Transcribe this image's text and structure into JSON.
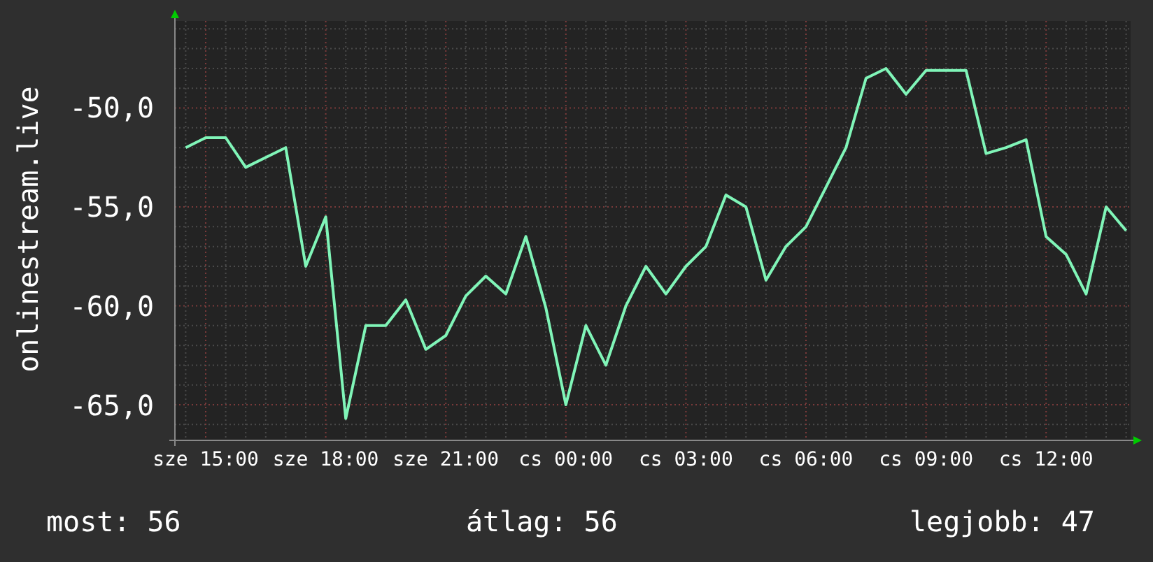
{
  "chart_data": {
    "type": "line",
    "grid": true,
    "ylabel": "onlinestream.live",
    "ylim": [
      -66.8,
      -45.6
    ],
    "categories": [
      null,
      "sze 15:00",
      null,
      null,
      null,
      null,
      null,
      "sze 18:00",
      null,
      null,
      null,
      null,
      null,
      "sze 21:00",
      null,
      null,
      null,
      null,
      null,
      "cs 00:00",
      null,
      null,
      null,
      null,
      null,
      "cs 03:00",
      null,
      null,
      null,
      null,
      null,
      "cs 06:00",
      null,
      null,
      null,
      null,
      null,
      "cs 09:00",
      null,
      null,
      null,
      null,
      null,
      "cs 12:00",
      null,
      null,
      null,
      null
    ],
    "yticks": [
      {
        "value": -50,
        "label": "-50,0"
      },
      {
        "value": -55,
        "label": "-55,0"
      },
      {
        "value": -60,
        "label": "-60,0"
      },
      {
        "value": -65,
        "label": "-65,0"
      }
    ],
    "series": [
      {
        "color": "#80f5b8",
        "values": [
          -52,
          -51.5,
          -51.5,
          -53,
          -52.5,
          -52,
          -58,
          -55.5,
          -65.7,
          -61,
          -61,
          -59.7,
          -62.2,
          -61.5,
          -59.5,
          -58.5,
          -59.4,
          -56.5,
          -60.1,
          -65,
          -61,
          -63,
          -60,
          -58,
          -59.4,
          -58,
          -57,
          -54.4,
          -55,
          -58.7,
          -57,
          -56,
          -54,
          -52,
          -48.5,
          -48,
          -49.3,
          -48.1,
          -48.1,
          -48.1,
          -52.3,
          -52,
          -51.6,
          -56.5,
          -57.4,
          -59.4,
          -55,
          -56.2
        ]
      }
    ]
  },
  "stats": [
    "most: 56",
    "átlag: 56",
    "legjobb: 47"
  ]
}
